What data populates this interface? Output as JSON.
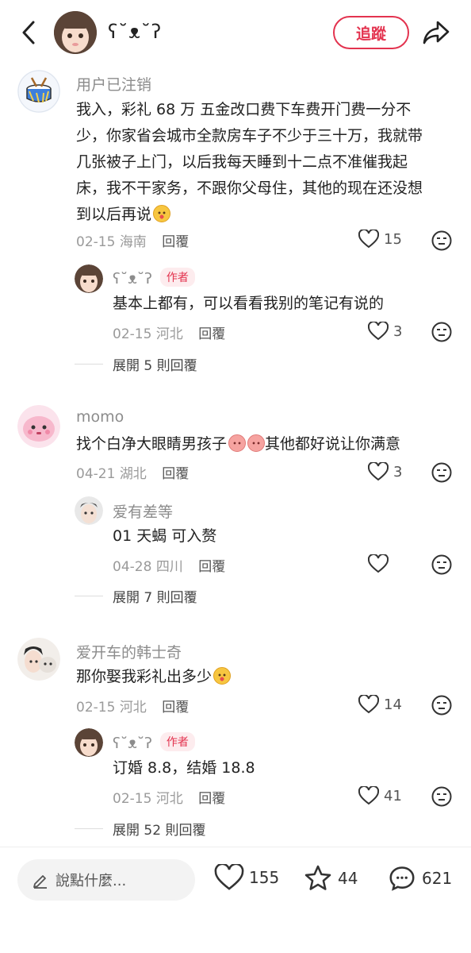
{
  "header": {
    "username": "ʕ˘ᴥ˘ʔ",
    "follow_label": "追蹤"
  },
  "comments": [
    {
      "name": "用户已注销",
      "lines": [
        "我入，彩礼 68 万 五金改口费下车费开门费一分不",
        "少，你家省会城市全款房车子不少于三十万，我就带",
        "几张被子上门，以后我每天睡到十二点不准催我起",
        "床，我不干家务，不跟你父母住，其他的现在还没想",
        "到以后再说"
      ],
      "date": "02-15",
      "location": "海南",
      "reply_label": "回覆",
      "likes": "15",
      "reply": {
        "name": "ʕ˘ᴥ˘ʔ",
        "badge": "作者",
        "text": "基本上都有，可以看看我别的笔记有说的",
        "date": "02-15",
        "location": "河北",
        "reply_label": "回覆",
        "likes": "3"
      },
      "expand_label": "展開 5 則回覆"
    },
    {
      "name": "momo",
      "text_a": "找个白净大眼睛男孩子",
      "text_b": "其他都好说让你满意",
      "date": "04-21",
      "location": "湖北",
      "reply_label": "回覆",
      "likes": "3",
      "reply": {
        "name": "爱有差等",
        "text": "01 天蝎 可入赘",
        "date": "04-28",
        "location": "四川",
        "reply_label": "回覆"
      },
      "expand_label": "展開 7 則回覆"
    },
    {
      "name": "爱开车的韩士奇",
      "text": "那你娶我彩礼出多少",
      "date": "02-15",
      "location": "河北",
      "reply_label": "回覆",
      "likes": "14",
      "reply": {
        "name": "ʕ˘ᴥ˘ʔ",
        "badge": "作者",
        "text": "订婚 8.8，结婚 18.8",
        "date": "02-15",
        "location": "河北",
        "reply_label": "回覆",
        "likes": "41"
      },
      "expand_label": "展開 52 則回覆"
    }
  ],
  "bottom": {
    "input_placeholder": "說點什麼...",
    "likes": "155",
    "stars": "44",
    "comments": "621"
  },
  "colors": {
    "accent": "#e3334f"
  }
}
